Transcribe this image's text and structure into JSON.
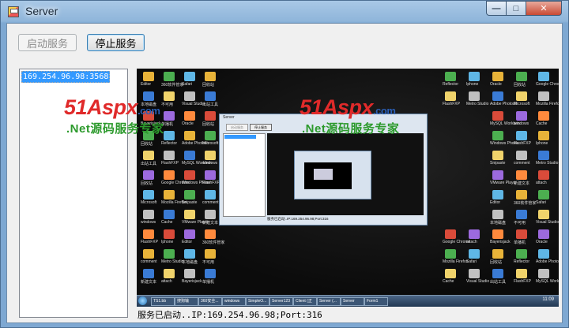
{
  "window": {
    "title": "Server"
  },
  "toolbar": {
    "start_label": "启动服务",
    "stop_label": "停止服务"
  },
  "clients": {
    "items": [
      "169.254.96.98:3568"
    ]
  },
  "status": {
    "text": "服务已启动..IP:169.254.96.98;Port:316"
  },
  "watermarks": [
    {
      "logo": "51Aspx",
      "domain": ".com",
      "slogan": ".Net源码服务专家"
    },
    {
      "logo": "51Aspx",
      "domain": ".com",
      "slogan": ".Net源码服务专家"
    }
  ],
  "preview": {
    "nested_window_title": "Server",
    "nested_start_label": "启动服务",
    "nested_stop_label": "停止服务",
    "nested_status": "服务已启动..IP:169.254.96.98;Port:316",
    "taskbar_tasks": [
      "TS1.bb",
      "搜狗输入...",
      "360安全...",
      "windows",
      "SimpleO...",
      "Server123",
      "Client (正在...",
      "Server (...",
      "Server",
      "Form1"
    ],
    "clock": "11:09",
    "desktop_labels": [
      "Editor",
      "本地磁盘",
      "Bayerisjack",
      "回收站",
      "出站工具",
      "回收站",
      "Microsoft",
      "windows",
      "FlashFXP",
      "comment",
      "新建文本",
      "360软件管家",
      "不可用",
      "单播机",
      "Reflector",
      "FlashFXP",
      "Google Chrome",
      "Mozilla Firefox",
      "Cache",
      "Iphone",
      "Metro Studio",
      "attach",
      "Safari",
      "Visual Studio",
      "Oracle",
      "Adobe Photosh",
      "MySQL Workben",
      "Windows Phone",
      "Snipaste",
      "VMware Player"
    ]
  },
  "colors": {
    "title_bar": "#8fb5da",
    "client_bg": "#f0f0f0",
    "list_selection": "#3399ff",
    "watermark_red": "#e02a2a",
    "watermark_blue": "#2b5fb6",
    "watermark_green": "#2c9a2c",
    "close_button": "#c94a34"
  },
  "icons": {
    "app": "server-app-icon",
    "minimize": "minimize-icon",
    "maximize": "maximize-icon",
    "close": "close-icon"
  }
}
